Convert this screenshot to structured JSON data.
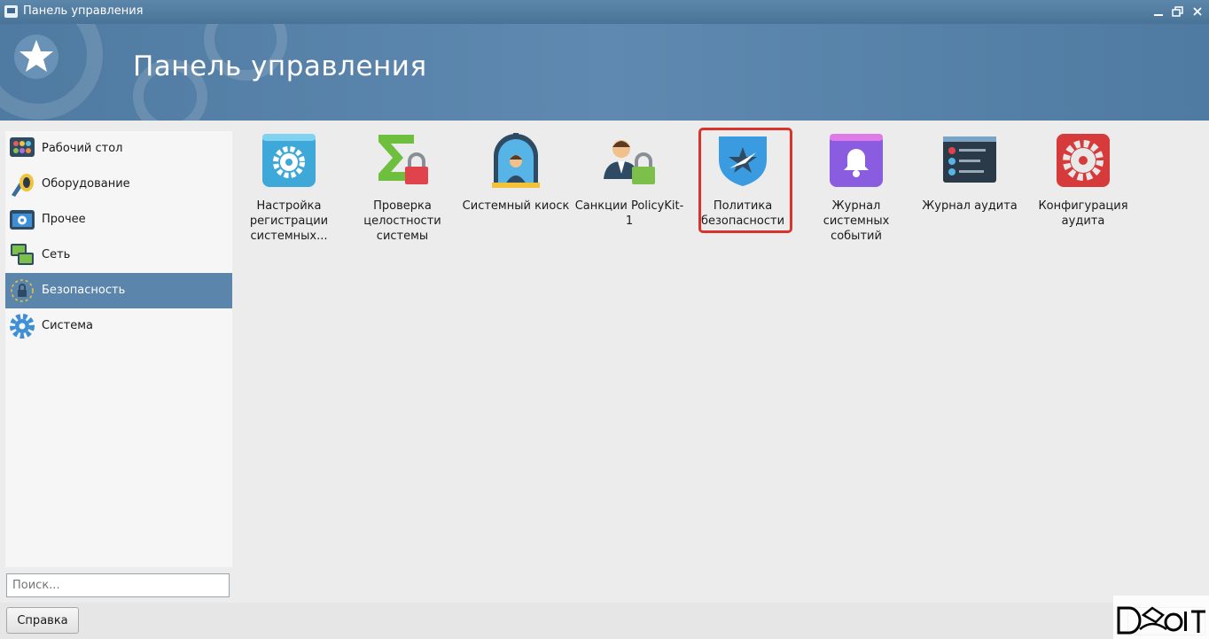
{
  "window": {
    "title": "Панель управления"
  },
  "banner": {
    "title": "Панель управления"
  },
  "sidebar": {
    "items": [
      {
        "label": "Рабочий стол",
        "icon": "desktop-icon"
      },
      {
        "label": "Оборудование",
        "icon": "hardware-icon"
      },
      {
        "label": "Прочее",
        "icon": "other-icon"
      },
      {
        "label": "Сеть",
        "icon": "network-icon"
      },
      {
        "label": "Безопасность",
        "icon": "security-icon"
      },
      {
        "label": "Система",
        "icon": "system-gear-icon"
      }
    ],
    "active": "Безопасность"
  },
  "search": {
    "placeholder": "Поиск..."
  },
  "tiles": [
    {
      "label": "Настройка регистрации системных...",
      "icon": "registration-settings-icon"
    },
    {
      "label": "Проверка целостности системы",
      "icon": "integrity-check-icon"
    },
    {
      "label": "Системный киоск",
      "icon": "system-kiosk-icon"
    },
    {
      "label": "Санкции PolicyKit-1",
      "icon": "policykit-sanctions-icon"
    },
    {
      "label": "Политика безопасности",
      "icon": "security-policy-icon"
    },
    {
      "label": "Журнал системных событий",
      "icon": "system-events-log-icon"
    },
    {
      "label": "Журнал аудита",
      "icon": "audit-log-icon"
    },
    {
      "label": "Конфигурация аудита",
      "icon": "audit-config-icon"
    }
  ],
  "footer": {
    "help_label": "Справка"
  },
  "colors": {
    "titlebar": "#4a7398",
    "accent": "#5b85ab",
    "highlight": "#d9342b"
  }
}
